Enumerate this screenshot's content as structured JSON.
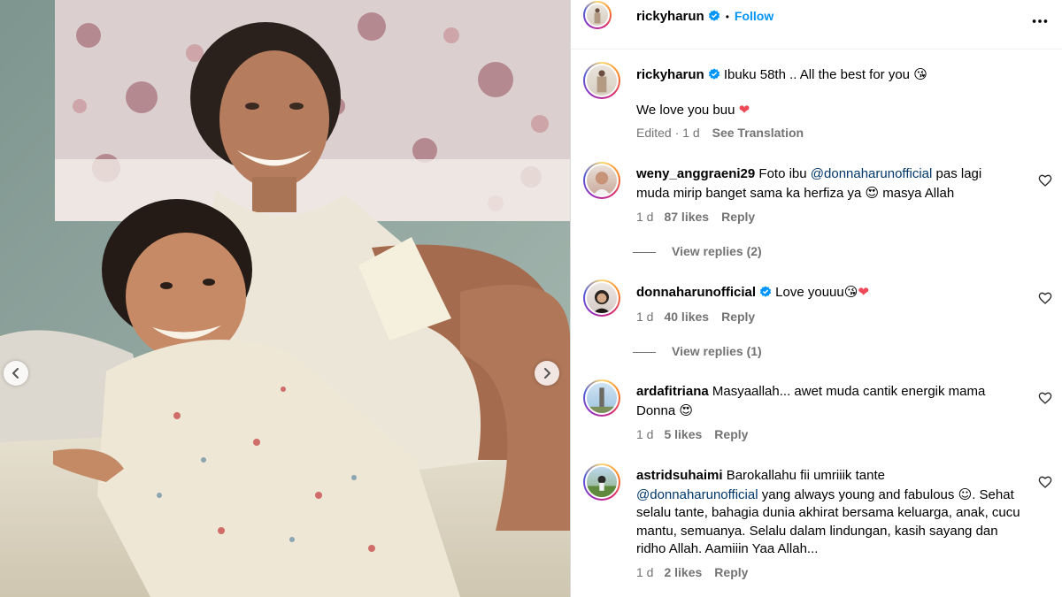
{
  "post": {
    "author": "rickyharun",
    "follow_label": "Follow",
    "separator": "•"
  },
  "caption": {
    "author": "rickyharun",
    "line1": "Ibuku 58th .. All the best for you",
    "line1_emoji": "😘",
    "line2": "We love you buu",
    "line2_emoji": "❤",
    "edited": "Edited · 1 d",
    "see_translation": "See Translation"
  },
  "comments": [
    {
      "user": "weny_anggraeni29",
      "text_a": "Foto ibu",
      "mention": "@donnaharunofficial",
      "text_b": "pas lagi muda mirip banget sama ka herfiza ya",
      "emoji": "😍",
      "text_c": "masya Allah",
      "time": "1 d",
      "likes": "87 likes",
      "reply": "Reply",
      "view_replies": "View replies (2)"
    },
    {
      "user": "donnaharunofficial",
      "text_a": "Love youuu",
      "emoji": "😘",
      "emoji2": "❤",
      "time": "1 d",
      "likes": "40 likes",
      "reply": "Reply",
      "view_replies": "View replies (1)"
    },
    {
      "user": "ardafitriana",
      "text_a": "Masyaallah... awet muda cantik energik mama Donna",
      "emoji": "😍",
      "time": "1 d",
      "likes": "5 likes",
      "reply": "Reply"
    },
    {
      "user": "astridsuhaimi",
      "text_a": "Barokallahu fii umriiik tante",
      "mention": "@donnaharunofficial",
      "text_b": "yang always young and fabulous",
      "emoji": "☺",
      "text_c": ". Sehat selalu tante, bahagia dunia akhirat bersama keluarga, anak, cucu mantu, semuanya. Selalu dalam lindungan, kasih sayang dan ridho Allah. Aamiiin Yaa Allah...",
      "time": "1 d",
      "likes": "2 likes",
      "reply": "Reply"
    }
  ],
  "icons": {
    "more": "more-horizontal-icon",
    "verified": "verified-badge-icon",
    "like": "heart-outline-icon",
    "prev": "chevron-left-icon",
    "next": "chevron-right-icon"
  },
  "colors": {
    "follow": "#0095f6",
    "verified": "#0095f6",
    "mention": "#00376b",
    "meta": "#737373",
    "heart": "#ed4956"
  }
}
